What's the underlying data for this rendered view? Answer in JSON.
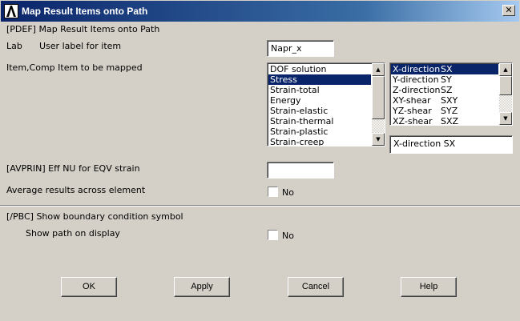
{
  "window": {
    "title": "Map Result Items onto Path",
    "close_glyph": "✕"
  },
  "header": {
    "label": "[PDEF]  Map Result Items onto Path"
  },
  "lab": {
    "key": "Lab",
    "description": "User label for item",
    "value": "Napr_x"
  },
  "item_comp": {
    "key": "Item,Comp  Item to be mapped",
    "items": [
      "DOF solution",
      "Stress",
      "Strain-total",
      "Energy",
      "Strain-elastic",
      "Strain-thermal",
      "Strain-plastic",
      "Strain-creep"
    ],
    "selected_item_index": 1,
    "components": [
      {
        "name": "X-direction",
        "code": "SX"
      },
      {
        "name": "Y-direction",
        "code": "SY"
      },
      {
        "name": "Z-direction",
        "code": "SZ"
      },
      {
        "name": "XY-shear",
        "code": "SXY"
      },
      {
        "name": "YZ-shear",
        "code": "SYZ"
      },
      {
        "name": "XZ-shear",
        "code": "SXZ"
      }
    ],
    "selected_component_index": 0,
    "selected_display": "X-direction   SX"
  },
  "avprin": {
    "label": "[AVPRIN]  Eff NU for EQV strain",
    "value": ""
  },
  "average": {
    "label": "Average results across element",
    "checkbox_label": "No",
    "checked": false
  },
  "pbc": {
    "label": "[/PBC]  Show boundary condition symbol"
  },
  "show_path": {
    "label": "Show path on display",
    "checkbox_label": "No",
    "checked": false
  },
  "buttons": {
    "ok": "OK",
    "apply": "Apply",
    "cancel": "Cancel",
    "help": "Help"
  },
  "icons": {
    "app": "ansys-logo-icon",
    "close": "close-icon",
    "scroll_up": "scroll-up-arrow-icon",
    "scroll_down": "scroll-down-arrow-icon"
  }
}
